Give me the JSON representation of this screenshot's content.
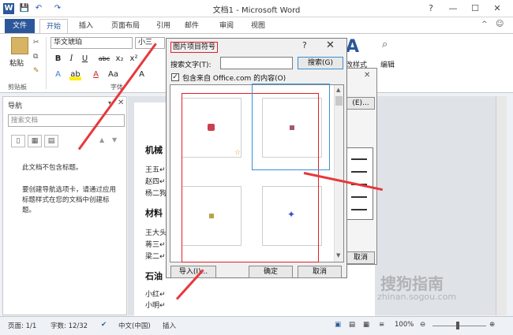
{
  "window": {
    "title": "文档1 - Microsoft Word"
  },
  "quick_access": {
    "save": "💾",
    "undo": "↶",
    "redo": "↷"
  },
  "tabs": [
    {
      "label": "文件"
    },
    {
      "label": "开始"
    },
    {
      "label": "插入"
    },
    {
      "label": "页面布局"
    },
    {
      "label": "引用"
    },
    {
      "label": "邮件"
    },
    {
      "label": "审阅"
    },
    {
      "label": "视图"
    }
  ],
  "ribbon": {
    "paste_label": "粘贴",
    "clipboard_label": "剪贴板",
    "font_name": "华文琥珀",
    "font_size": "小三",
    "font_group_label": "字体",
    "bold": "B",
    "italic": "I",
    "underline": "U",
    "strike": "abc",
    "subscript": "x₂",
    "superscript": "x²",
    "edit_label": "编辑",
    "styles_label": "改样式"
  },
  "nav": {
    "title": "导航",
    "search_placeholder": "搜索文档",
    "msg1": "此文档不包含标题。",
    "msg2": "要创建导航选项卡，请通过应用标题样式在您的文档中创建标题。"
  },
  "document": {
    "heading1": "机械",
    "lines1": [
      "王五↵",
      "赵四↵",
      "杨二狗"
    ],
    "heading2": "材料",
    "lines2": [
      "王大头",
      "蒋三↵",
      "梁二↵"
    ],
    "heading3": "石油",
    "lines3": [
      "小红↵",
      "小明↵"
    ]
  },
  "dialog": {
    "title": "图片项目符号",
    "help": "?",
    "close": "✕",
    "search_label": "搜索文字(T):",
    "search_value": "",
    "search_button": "搜索(G)",
    "include_checkbox": "包含来自 Office.com 的内容(O)",
    "include_checked": true,
    "import_button": "导入(I)...",
    "ok_button": "确定",
    "cancel_button": "取消"
  },
  "behind_dialog": {
    "button": "(E)...",
    "cancel_label": "取消"
  },
  "status": {
    "page": "页面: 1/1",
    "words": "字数: 12/32",
    "lang": "中文(中国)",
    "mode": "插入",
    "zoom": "100%"
  },
  "watermark": {
    "text": "搜狗指南",
    "url": "zhinan.sogou.com"
  },
  "colors": {
    "accent": "#2b579a",
    "highlight": "#e0202a",
    "arrow": "#e8383c",
    "selection": "#3a8fd6"
  }
}
